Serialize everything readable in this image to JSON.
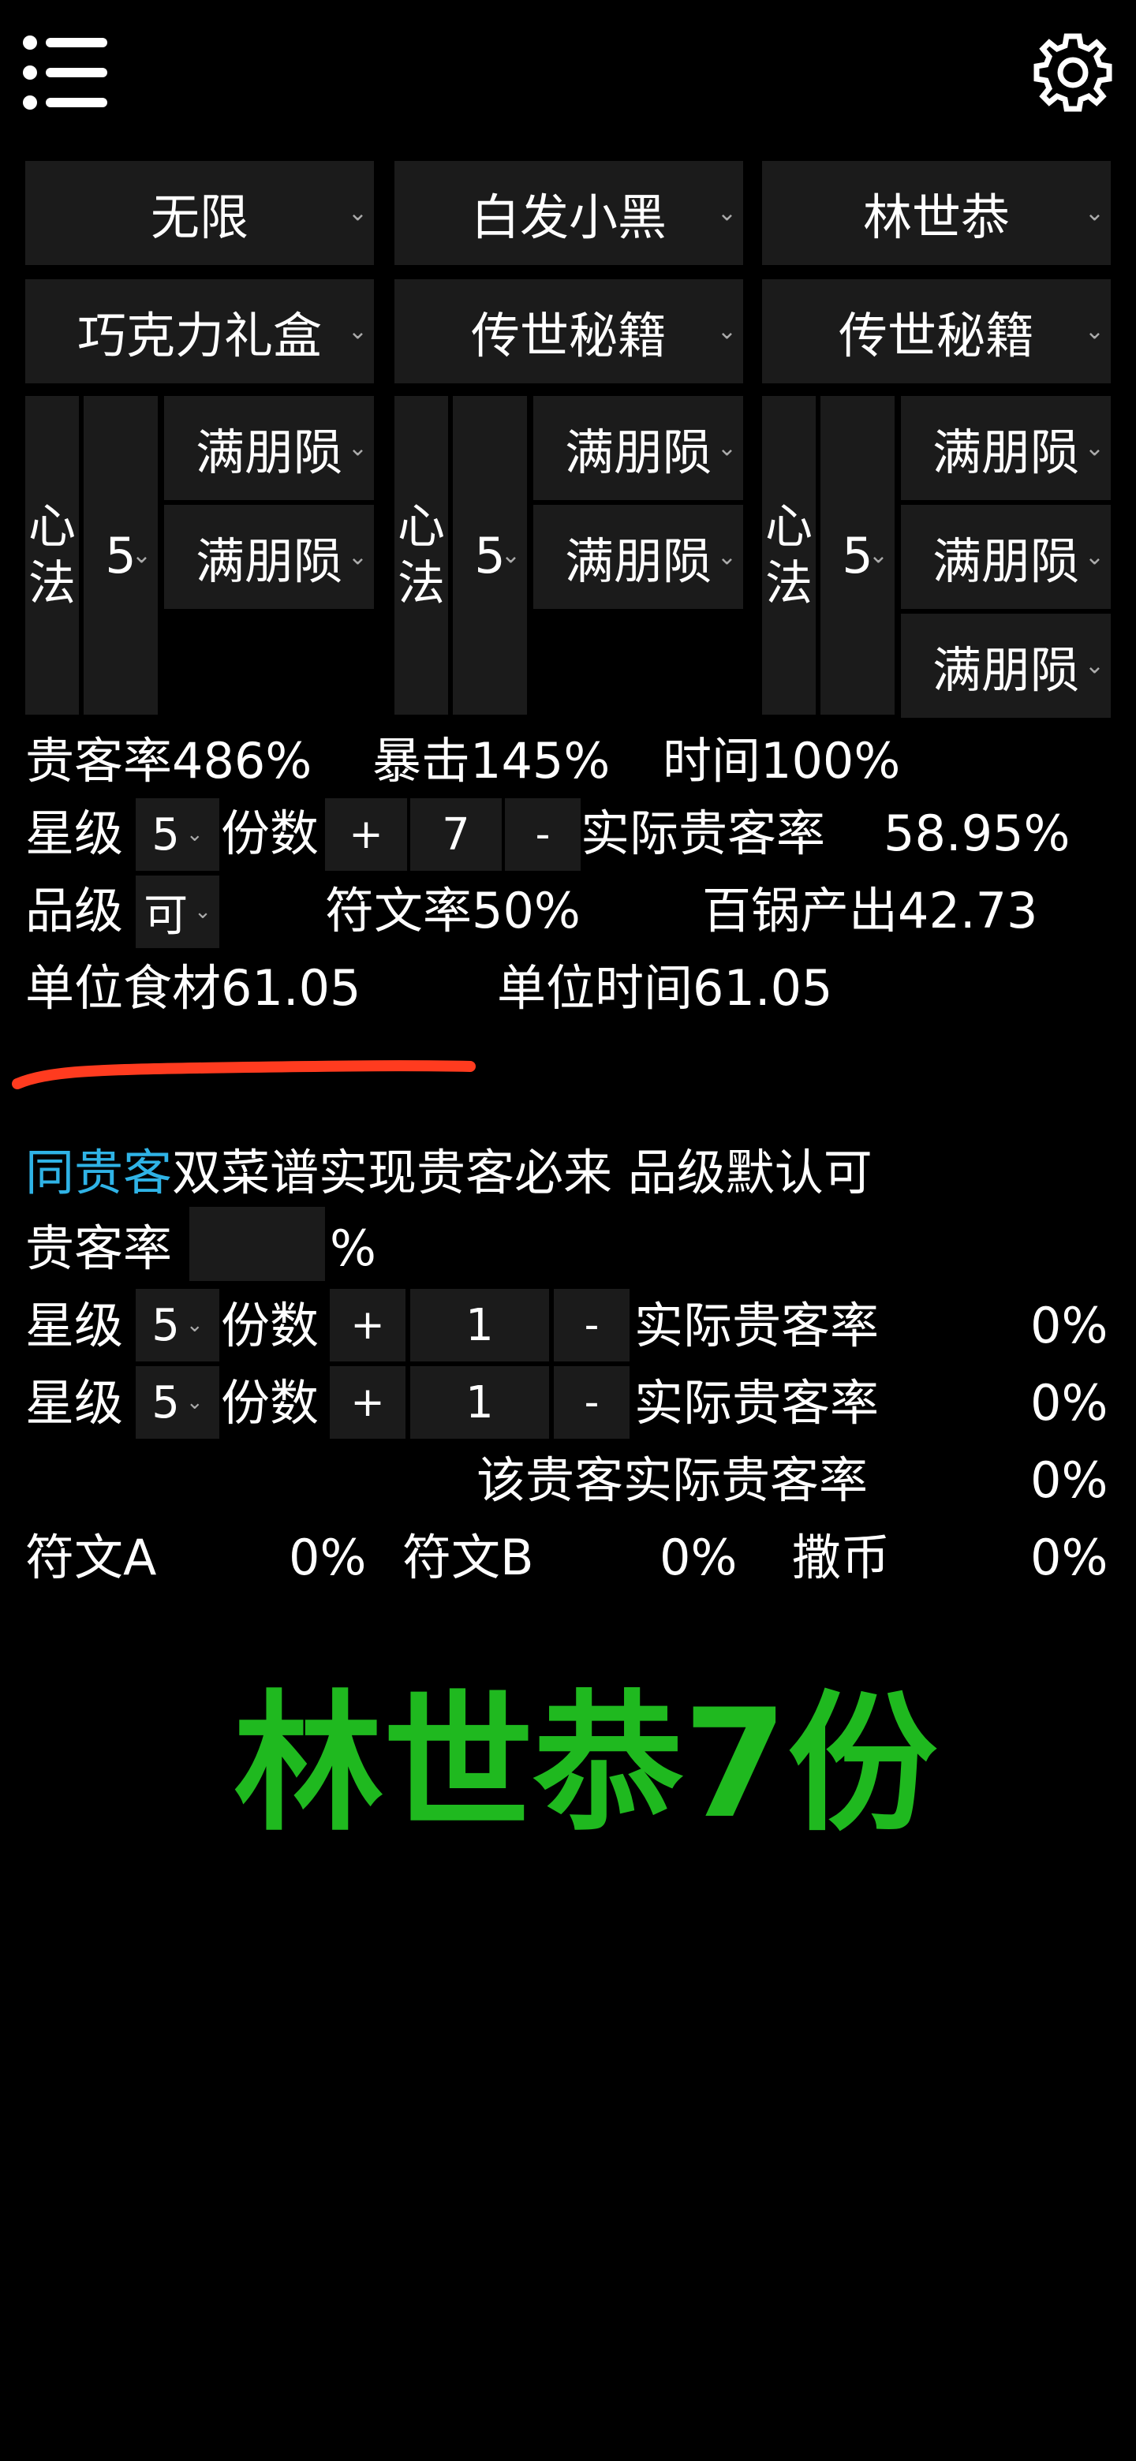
{
  "header": {
    "menu_icon": "hamburger-menu-icon",
    "settings_icon": "gear-icon"
  },
  "row1": [
    "无限",
    "白发小黑",
    "林世恭"
  ],
  "row2": [
    "巧克力礼盒",
    "传世秘籍",
    "传世秘籍"
  ],
  "chefs": [
    {
      "xinfa": "心法",
      "level": "5",
      "skills": [
        "满朋陨",
        "满朋陨"
      ]
    },
    {
      "xinfa": "心法",
      "level": "5",
      "skills": [
        "满朋陨",
        "满朋陨"
      ]
    },
    {
      "xinfa": "心法",
      "level": "5",
      "skills": [
        "满朋陨",
        "满朋陨",
        "满朋陨"
      ]
    }
  ],
  "stats": {
    "guest_rate": "贵客率486%",
    "crit": "暴击145%",
    "time": "时间100%",
    "star_label": "星级",
    "star_value": "5",
    "portion_label": "份数",
    "plus": "+",
    "portion_value": "7",
    "minus": "-",
    "actual_rate_label": "实际贵客率",
    "actual_rate_value": "58.95%",
    "grade_label": "品级",
    "grade_value": "可",
    "rune_rate": "符文率50%",
    "pot_output": "百锅产出42.73",
    "unit_food": "单位食材61.05",
    "unit_time": "单位时间61.05"
  },
  "same_guest": {
    "title_highlight": "同贵客",
    "title_rest": "双菜谱实现贵客必来 品级默认可",
    "rate_label": "贵客率",
    "rate_value": "",
    "rate_unit": "%",
    "rows": [
      {
        "star_label": "星级",
        "star": "5",
        "portion_label": "份数",
        "plus": "+",
        "portion": "1",
        "minus": "-",
        "actual_label": "实际贵客率",
        "actual": "0%"
      },
      {
        "star_label": "星级",
        "star": "5",
        "portion_label": "份数",
        "plus": "+",
        "portion": "1",
        "minus": "-",
        "actual_label": "实际贵客率",
        "actual": "0%"
      }
    ],
    "guest_actual_label": "该贵客实际贵客率",
    "guest_actual": "0%",
    "rune_a_label": "符文A",
    "rune_a": "0%",
    "rune_b_label": "符文B",
    "rune_b": "0%",
    "coin_label": "撒币",
    "coin": "0%"
  },
  "annotation": {
    "big_text": "林世恭7份",
    "color": "#1fb91f",
    "underline_color": "#ff3b1f"
  }
}
